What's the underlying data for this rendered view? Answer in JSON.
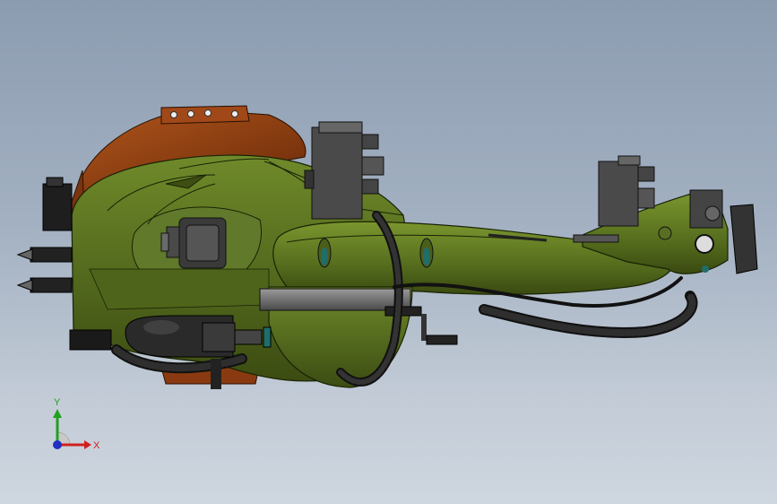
{
  "view": {
    "background_top": "#8c9cb0",
    "background_bottom": "#ced6df"
  },
  "model": {
    "body_color": "#556b1e",
    "flange_color": "#8a3a10",
    "component_color": "#2a2a2a",
    "port_color": "#1f6e6a"
  },
  "triad": {
    "x_label": "X",
    "y_label": "Y",
    "x_color": "#d02020",
    "y_color": "#20a020",
    "z_color": "#2030c0"
  }
}
